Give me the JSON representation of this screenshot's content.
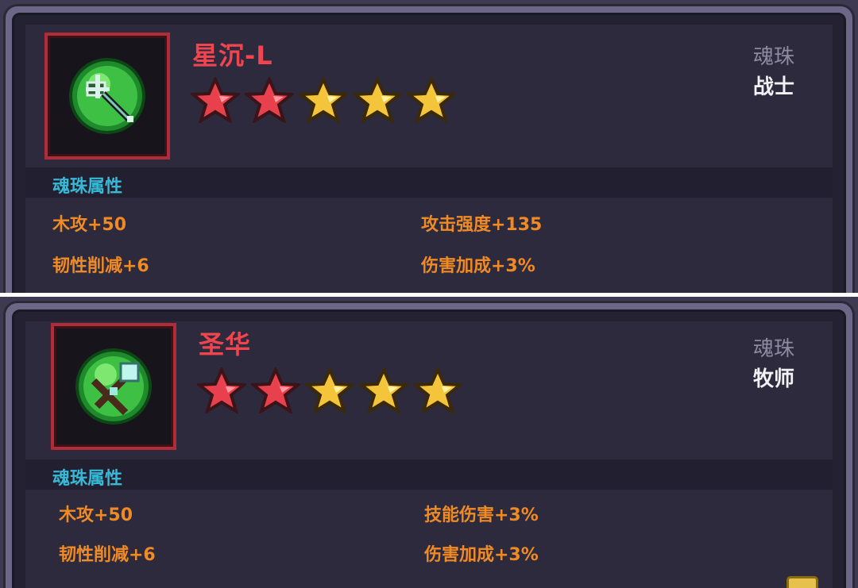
{
  "items": [
    {
      "name": "星沉-L",
      "category": "魂珠",
      "class_name": "战士",
      "stars": {
        "filled_red": 2,
        "filled_gold": 3,
        "total": 5
      },
      "section_title": "魂珠属性",
      "attributes": [
        "木攻+50",
        "攻击强度+135",
        "韧性削减+6",
        "伤害加成+3%"
      ],
      "icon": "mace-orb-icon"
    },
    {
      "name": "圣华",
      "category": "魂珠",
      "class_name": "牧师",
      "stars": {
        "filled_red": 2,
        "filled_gold": 3,
        "total": 5
      },
      "section_title": "魂珠属性",
      "attributes": [
        "木攻+50",
        "技能伤害+3%",
        "韧性削减+6",
        "伤害加成+3%"
      ],
      "icon": "staff-orb-icon"
    }
  ],
  "colors": {
    "star_red": "#e8404c",
    "star_gold": "#f4c43a",
    "attr_text": "#f08a24",
    "section_title": "#35b9d6",
    "name_text": "#f0444f"
  }
}
